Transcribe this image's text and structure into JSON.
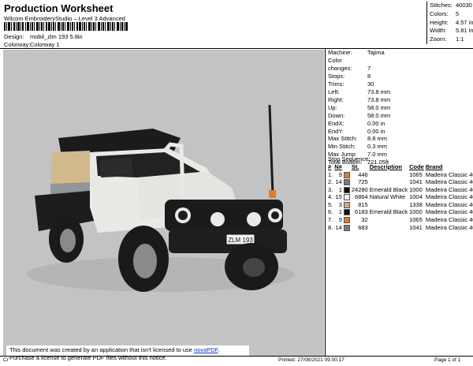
{
  "header": {
    "title": "Production Worksheet",
    "subtitle": "Wilcom EmbroideryStudio – Level 3 Advanced",
    "design_label": "Design:",
    "design_value": "mobil_zlm 193 5.8in",
    "colorway_label": "Colorway:",
    "colorway_value": "Colorway 1"
  },
  "summary": [
    {
      "k": "Stitches:",
      "v": "40030"
    },
    {
      "k": "Colors:",
      "v": "5"
    },
    {
      "k": "Height:",
      "v": "4.57 in"
    },
    {
      "k": "Width:",
      "v": "5.81 in"
    },
    {
      "k": "Zoom:",
      "v": "1:1"
    }
  ],
  "specs": [
    {
      "k": "Machine:",
      "v": "Tajima"
    },
    {
      "k": "Color changes:",
      "v": "7"
    },
    {
      "k": "Stops:",
      "v": "8"
    },
    {
      "k": "Trims:",
      "v": "30"
    },
    {
      "k": "Left:",
      "v": "73.8 mm"
    },
    {
      "k": "Right:",
      "v": "73.8 mm"
    },
    {
      "k": "Up:",
      "v": "58.0 mm"
    },
    {
      "k": "Down:",
      "v": "58.0 mm"
    },
    {
      "k": "EndX:",
      "v": "0.00 in"
    },
    {
      "k": "EndY:",
      "v": "0.00 in"
    },
    {
      "k": "Max Stitch:",
      "v": "8.8 mm"
    },
    {
      "k": "Min Stitch:",
      "v": "0.3 mm"
    },
    {
      "k": "Max Jump:",
      "v": "7.0 mm"
    },
    {
      "k": "Total Bobbin:",
      "v": "221.05ft"
    }
  ],
  "stop_sequence": {
    "title": "Stop Sequence:",
    "headers": [
      "#",
      "N#",
      "",
      "St.",
      "Description",
      "Code",
      "Brand"
    ],
    "rows": [
      {
        "idx": "1.",
        "n": "9",
        "color": "#e07b2a",
        "st": "446",
        "desc": "",
        "code": "1065",
        "brand": "Madeira Classic 40"
      },
      {
        "idx": "2.",
        "n": "14",
        "color": "#7a7a7a",
        "st": "725",
        "desc": "",
        "code": "1041",
        "brand": "Madeira Classic 40"
      },
      {
        "idx": "3.",
        "n": "1",
        "color": "#111111",
        "st": "24280",
        "desc": "Emerald Black",
        "code": "1000",
        "brand": "Madeira Classic 40"
      },
      {
        "idx": "4.",
        "n": "15",
        "color": "#f4f4f0",
        "st": "6864",
        "desc": "Natural White",
        "code": "1004",
        "brand": "Madeira Classic 40"
      },
      {
        "idx": "5.",
        "n": "3",
        "color": "#c8ac82",
        "st": "815",
        "desc": "",
        "code": "1338",
        "brand": "Madeira Classic 40"
      },
      {
        "idx": "6.",
        "n": "1",
        "color": "#111111",
        "st": "6183",
        "desc": "Emerald Black",
        "code": "1000",
        "brand": "Madeira Classic 40"
      },
      {
        "idx": "7.",
        "n": "9",
        "color": "#e07b2a",
        "st": "32",
        "desc": "",
        "code": "1065",
        "brand": "Madeira Classic 40"
      },
      {
        "idx": "8.",
        "n": "14",
        "color": "#7a7a7a",
        "st": "683",
        "desc": "",
        "code": "1041",
        "brand": "Madeira Classic 40"
      }
    ]
  },
  "plate": "ZLM 193",
  "nova": {
    "line1_pre": "This document was created by an application that isn't licensed to use ",
    "line1_link": "novaPDF",
    "line1_post": ".",
    "line2": "Purchase a license to generate PDF files without this notice."
  },
  "footer": {
    "left": "Cr",
    "printed": "Printed: 27/08/2021 09.00.17",
    "page": "Page 1 of 1"
  },
  "colors": {
    "canvas": "#c3c3c3",
    "truck_body": "#e9e9e6",
    "truck_dark": "#1b1b1b",
    "canopy": "#d2b98c"
  }
}
